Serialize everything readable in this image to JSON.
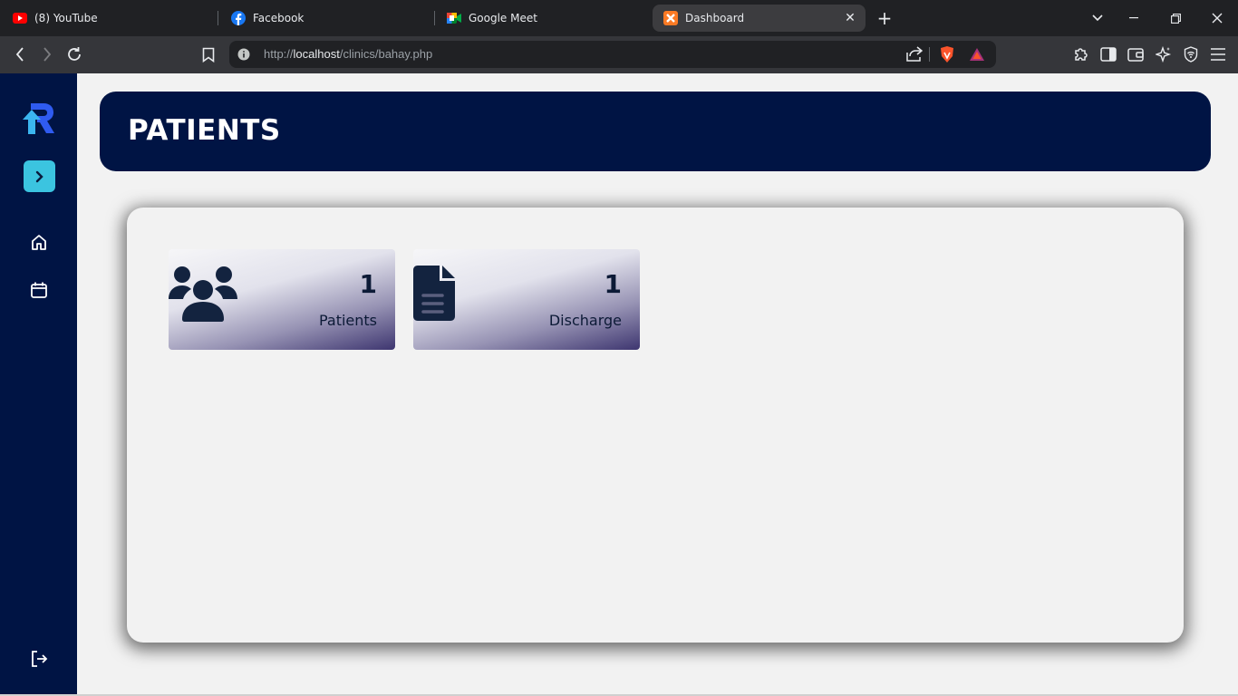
{
  "browser": {
    "tabs": [
      {
        "title": "(8) YouTube",
        "icon": "youtube-icon"
      },
      {
        "title": "Facebook",
        "icon": "facebook-icon"
      },
      {
        "title": "Google Meet",
        "icon": "google-meet-icon"
      },
      {
        "title": "Dashboard",
        "icon": "xampp-icon",
        "active": true
      }
    ],
    "url": "http://localhost/clinics/bahay.php",
    "new_tab_label": "+"
  },
  "sidebar": {
    "accent_color": "#3bc4e0",
    "background_color": "#001444"
  },
  "header": {
    "title": "PATIENTS"
  },
  "cards": [
    {
      "count": "1",
      "label": "Patients",
      "icon": "users-icon"
    },
    {
      "count": "1",
      "label": "Discharge",
      "icon": "document-icon"
    }
  ]
}
